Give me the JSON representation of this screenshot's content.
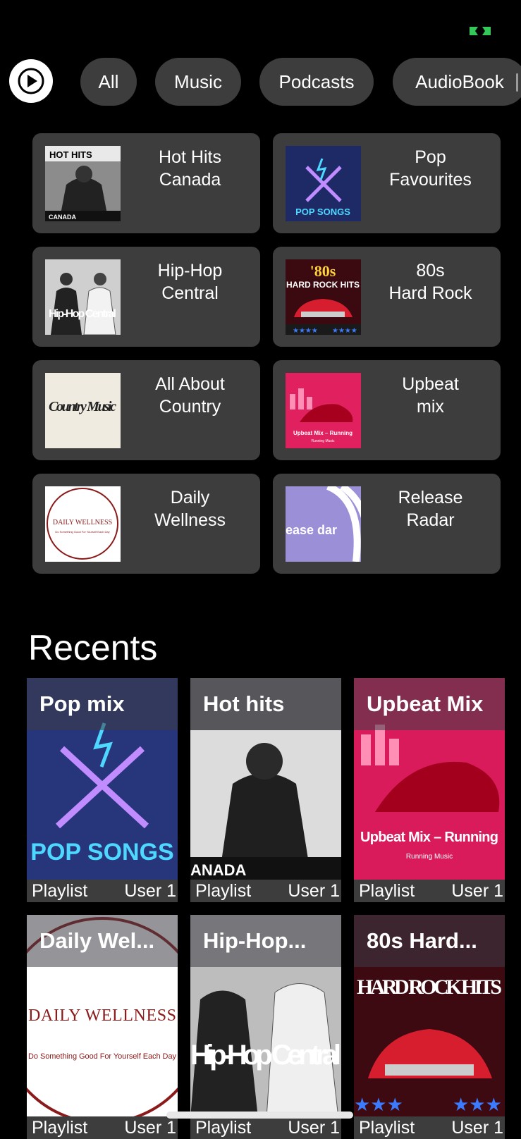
{
  "status": {
    "icon": "battery-saver-icon",
    "color": "#34c759"
  },
  "filters": {
    "play_icon": "play-circle-icon",
    "chips": [
      "All",
      "Music",
      "Podcasts",
      "AudioBook"
    ]
  },
  "quick_picks": [
    {
      "title": "Hot Hits\nCanada",
      "art_text": "HOT HITS",
      "art_sub": "CANADA"
    },
    {
      "title": "Pop\nFavourites",
      "art_text": "POP SONGS"
    },
    {
      "title": "Hip-Hop\nCentral",
      "art_text": "Hip-Hop Central"
    },
    {
      "title": "80s\nHard Rock",
      "art_text": "'80s",
      "art_sub": "HARD ROCK HITS"
    },
    {
      "title": "All About\nCountry",
      "art_text": "Country Music"
    },
    {
      "title": "Upbeat\nmix",
      "art_text": "Upbeat Mix – Running",
      "art_sub": "Running Music"
    },
    {
      "title": "Daily\nWellness",
      "art_text": "DAILY WELLNESS",
      "art_sub": "Do Something Good For Yourself Each Day"
    },
    {
      "title": "Release\nRadar",
      "art_text": "ease\ndar"
    }
  ],
  "recents": {
    "title": "Recents",
    "items": [
      {
        "name": "Pop mix",
        "type": "Playlist",
        "owner": "User 1",
        "art_text": "POP SONGS"
      },
      {
        "name": "Hot hits",
        "type": "Playlist",
        "owner": "User 1",
        "art_text": "ANADA"
      },
      {
        "name": "Upbeat Mix",
        "type": "Playlist",
        "owner": "User 1",
        "art_text": "Upbeat Mix – Running",
        "art_sub": "Running Music"
      },
      {
        "name": "Daily Wel...",
        "type": "Playlist",
        "owner": "User 1",
        "art_text": "DAILY WELLNESS",
        "art_sub": "Do Something Good For Yourself Each Day"
      },
      {
        "name": "Hip-Hop...",
        "type": "Playlist",
        "owner": "User 1",
        "art_text": "Hip-Hop Central"
      },
      {
        "name": "80s Hard...",
        "type": "Playlist",
        "owner": "User 1",
        "art_text": "HARD ROCK HITS"
      }
    ]
  }
}
